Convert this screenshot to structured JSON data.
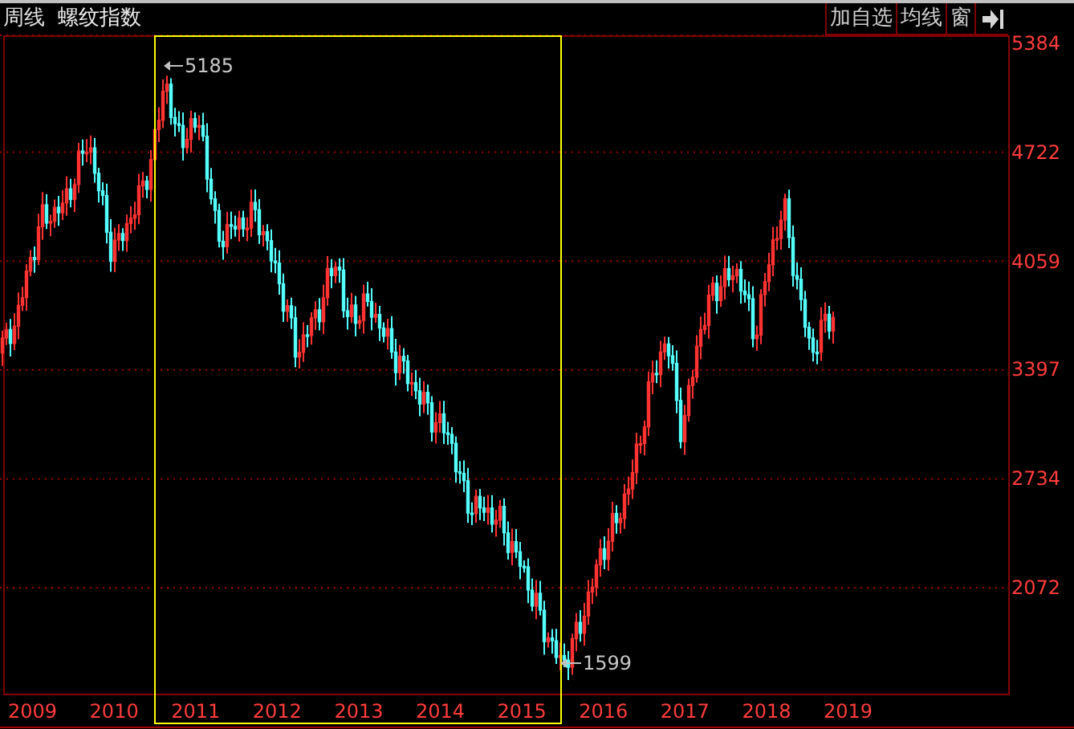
{
  "header": {
    "period": "周线",
    "instrument": "螺纹指数"
  },
  "toolbar": [
    {
      "label": "加自选"
    },
    {
      "label": "均线"
    },
    {
      "label": "窗"
    }
  ],
  "y_axis": {
    "labels": [
      "5384",
      "4722",
      "4059",
      "3397",
      "2734",
      "2072"
    ]
  },
  "x_axis": {
    "labels": [
      "2009",
      "2010",
      "2011",
      "2012",
      "2013",
      "2014",
      "2015",
      "2016",
      "2017",
      "2018",
      "2019"
    ]
  },
  "annotations": [
    {
      "kind": "high",
      "label": "5185"
    },
    {
      "kind": "low",
      "label": "1599"
    }
  ]
}
